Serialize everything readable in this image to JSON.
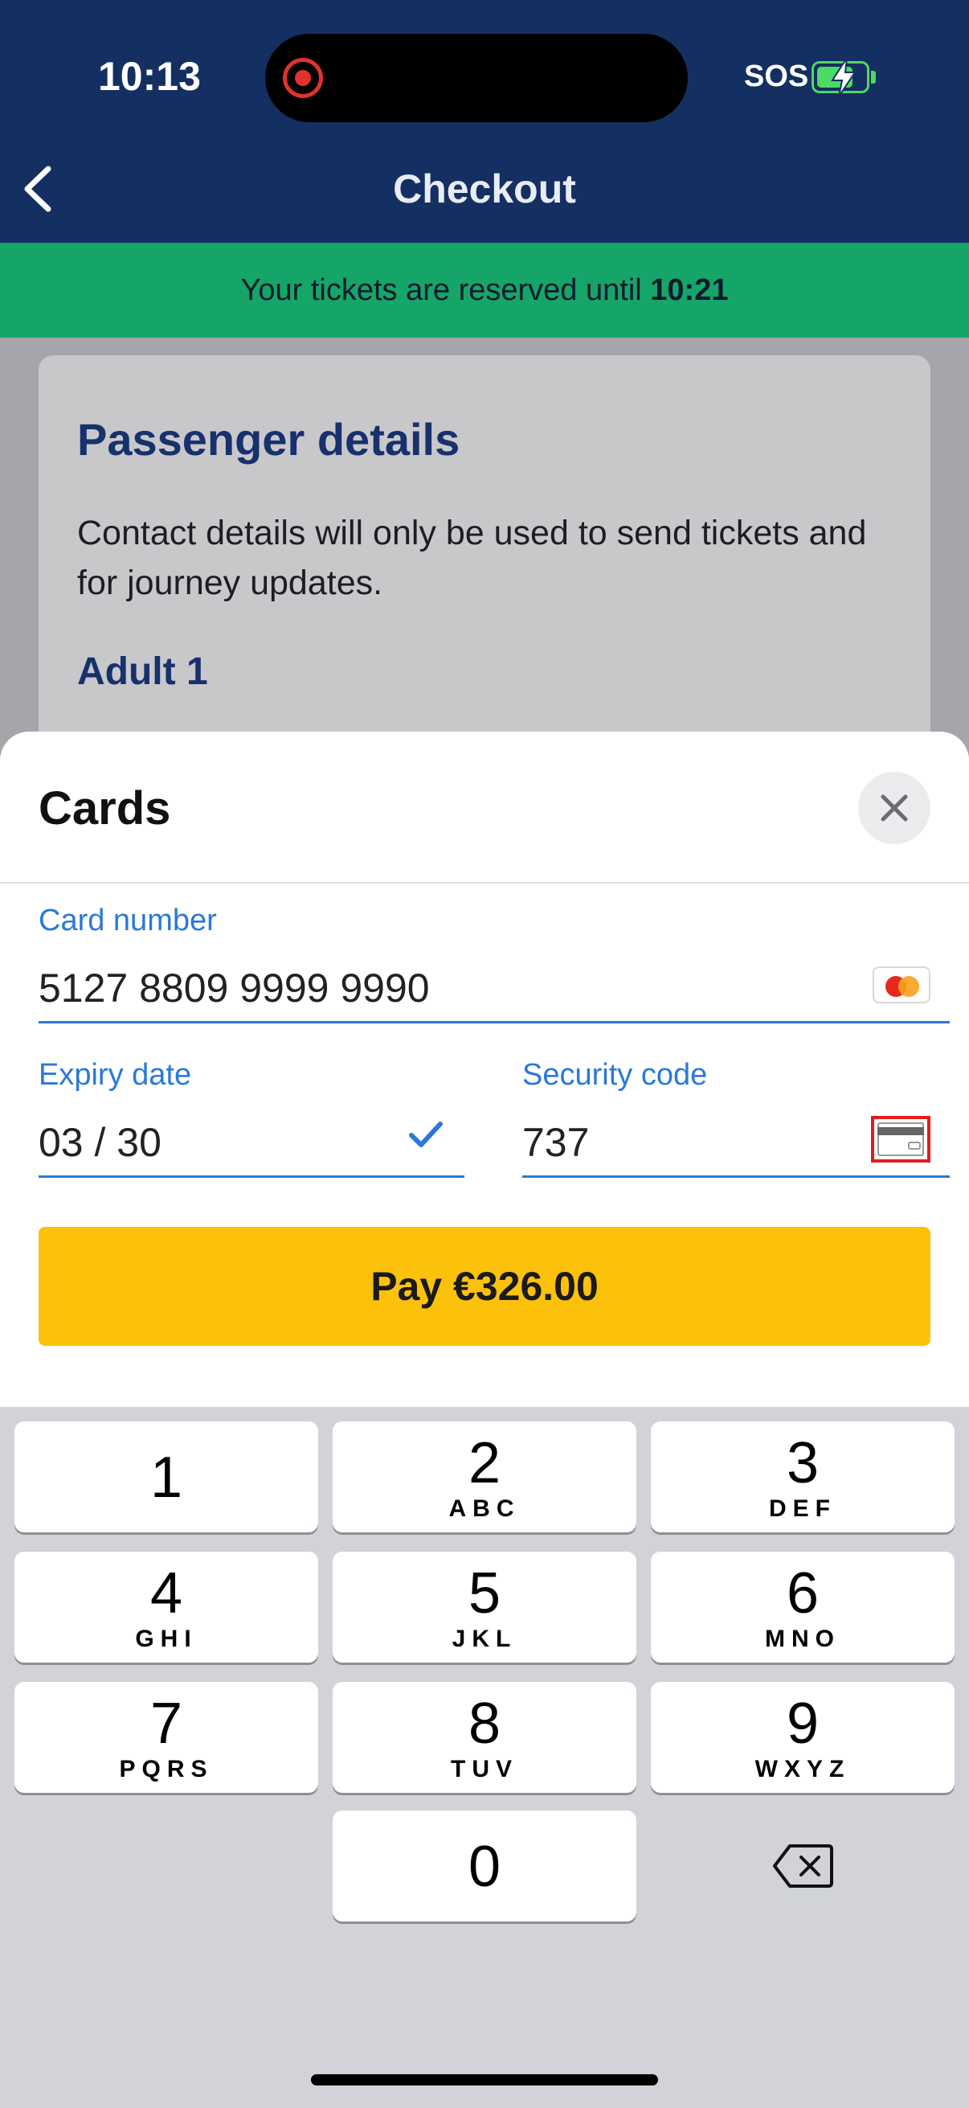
{
  "status_bar": {
    "time": "10:13",
    "sos": "SOS"
  },
  "header": {
    "title": "Checkout"
  },
  "banner": {
    "prefix": "Your tickets are reserved until ",
    "time": "10:21"
  },
  "background": {
    "section_title": "Passenger details",
    "description": "Contact details will only be used to send tickets and for journey updates.",
    "adult_label": "Adult 1"
  },
  "sheet": {
    "title": "Cards",
    "card_number": {
      "label": "Card number",
      "value": "5127 8809 9999 9990"
    },
    "expiry": {
      "label": "Expiry date",
      "value": "03 / 30"
    },
    "security": {
      "label": "Security code",
      "value": "737"
    },
    "pay_label": "Pay €326.00"
  },
  "keyboard": {
    "keys": [
      {
        "num": "1",
        "letters": ""
      },
      {
        "num": "2",
        "letters": "ABC"
      },
      {
        "num": "3",
        "letters": "DEF"
      },
      {
        "num": "4",
        "letters": "GHI"
      },
      {
        "num": "5",
        "letters": "JKL"
      },
      {
        "num": "6",
        "letters": "MNO"
      },
      {
        "num": "7",
        "letters": "PQRS"
      },
      {
        "num": "8",
        "letters": "TUV"
      },
      {
        "num": "9",
        "letters": "WXYZ"
      },
      {
        "num": "0",
        "letters": ""
      }
    ]
  },
  "colors": {
    "header_bg": "#142f61",
    "banner_bg": "#15a569",
    "accent": "#2a79d9",
    "pay_button": "#fcc10b"
  }
}
